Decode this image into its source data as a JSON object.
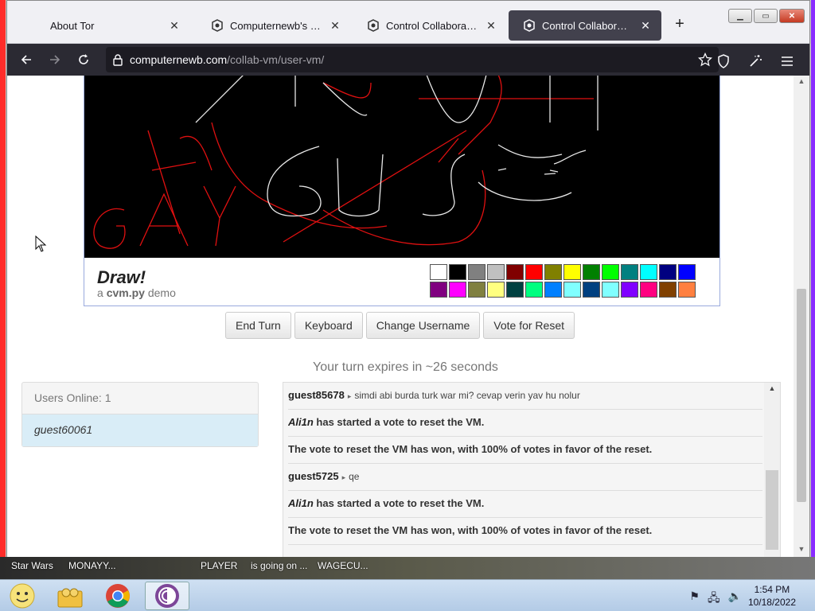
{
  "browser": {
    "tabs": [
      {
        "title": "About Tor",
        "active": false
      },
      {
        "title": "Computernewb's Internet",
        "active": false
      },
      {
        "title": "Control Collaborative Virtu",
        "active": false
      },
      {
        "title": "Control Collaborative Virtu",
        "active": true
      }
    ],
    "new_tab_icon": "plus-icon",
    "url": {
      "domain": "computernewb.com",
      "path": "/collab-vm/user-vm/"
    }
  },
  "draw": {
    "title": "Draw!",
    "subtitle_prefix": "a",
    "subtitle_bold": "cvm.py",
    "subtitle_suffix": "demo",
    "palette": [
      "#ffffff",
      "#000000",
      "#808080",
      "#c0c0c0",
      "#800000",
      "#ff0000",
      "#808000",
      "#ffff00",
      "#008000",
      "#00ff00",
      "#008080",
      "#00ffff",
      "#000080",
      "#0000ff",
      "#800080",
      "#ff00ff",
      "#808040",
      "#ffff80",
      "#004040",
      "#00ff80",
      "#0080ff",
      "#80ffff",
      "#004080",
      "#80ffff",
      "#8000ff",
      "#ff0080",
      "#804000",
      "#ff8040"
    ]
  },
  "buttons": {
    "end_turn": "End Turn",
    "keyboard": "Keyboard",
    "change_username": "Change Username",
    "vote_reset": "Vote for Reset"
  },
  "turn_text": "Your turn expires in ~26 seconds",
  "users": {
    "header": "Users Online: 1",
    "list": [
      "guest60061"
    ]
  },
  "chat": {
    "messages": [
      {
        "user": "guest85678",
        "text": "simdi abi burda turk war mi? cevap verin yav hu nolur"
      },
      {
        "name": "Ali1n",
        "text": "has started a vote to reset the VM."
      },
      {
        "system": "The vote to reset the VM has won, with 100% of votes in favor of the reset."
      },
      {
        "user": "guest5725",
        "text": "qe"
      },
      {
        "name": "Ali1n",
        "text": "has started a vote to reset the VM."
      },
      {
        "system": "The vote to reset the VM has won, with 100% of votes in favor of the reset."
      }
    ]
  },
  "desktop_labels": [
    "Star Wars",
    "MONAYY...",
    "PLAYER",
    "is going on ...",
    "WAGECU..."
  ],
  "taskbar": {
    "time": "1:54 PM",
    "date": "10/18/2022"
  }
}
